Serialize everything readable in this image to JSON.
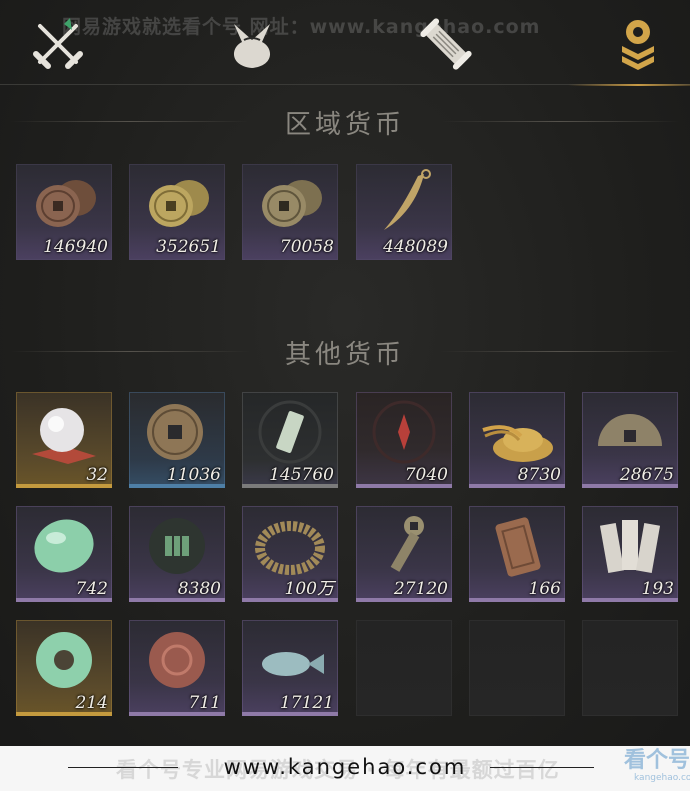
{
  "watermark_top": "网易游戏就选看个号  网址：www.kangehao.com",
  "tabs": [
    {
      "name": "weapons",
      "icon": "crossed-swords-icon",
      "active": false
    },
    {
      "name": "bag",
      "icon": "pouch-icon",
      "active": false
    },
    {
      "name": "scroll",
      "icon": "scroll-icon",
      "active": false
    },
    {
      "name": "currency",
      "icon": "coin-stack-icon",
      "active": true
    }
  ],
  "sections": {
    "regional": {
      "title": "区域货币",
      "items": [
        {
          "icon": "copper-coins-icon",
          "count": "146940"
        },
        {
          "icon": "brass-coins-icon",
          "count": "352651"
        },
        {
          "icon": "bronze-coins-icon",
          "count": "70058"
        },
        {
          "icon": "blade-token-icon",
          "count": "448089"
        }
      ]
    },
    "other": {
      "title": "其他货币",
      "items": [
        {
          "icon": "pearl-icon",
          "count": "32",
          "rarity": "gold"
        },
        {
          "icon": "ancient-coin-icon",
          "count": "11036",
          "rarity": "blue"
        },
        {
          "icon": "jade-tag-icon",
          "count": "145760",
          "rarity": "gray"
        },
        {
          "icon": "red-seal-icon",
          "count": "7040",
          "rarity": "purple"
        },
        {
          "icon": "grain-pile-icon",
          "count": "8730",
          "rarity": "purple"
        },
        {
          "icon": "half-coin-icon",
          "count": "28675",
          "rarity": "purple"
        },
        {
          "icon": "jade-stone-icon",
          "count": "742",
          "rarity": "purple"
        },
        {
          "icon": "map-token-icon",
          "count": "8380",
          "rarity": "purple"
        },
        {
          "icon": "coin-string-icon",
          "count": "100万",
          "rarity": "purple"
        },
        {
          "icon": "key-coin-icon",
          "count": "27120",
          "rarity": "purple"
        },
        {
          "icon": "bronze-plaque-icon",
          "count": "166",
          "rarity": "purple"
        },
        {
          "icon": "paper-notes-icon",
          "count": "193",
          "rarity": "purple"
        },
        {
          "icon": "jade-disc-icon",
          "count": "214",
          "rarity": "gold"
        },
        {
          "icon": "red-stone-icon",
          "count": "711",
          "rarity": "purple"
        },
        {
          "icon": "jade-fish-icon",
          "count": "17121",
          "rarity": "purple"
        }
      ]
    }
  },
  "bottom": {
    "ghost_text": "看个号专业网易游戏交易 · 每年有最额过百亿",
    "url": "www.kangehao.com",
    "logo_big": "看个号",
    "logo_small": "kangehao.com"
  }
}
